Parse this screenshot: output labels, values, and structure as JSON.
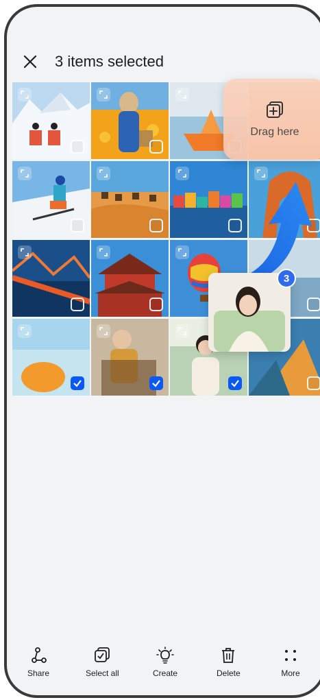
{
  "header": {
    "title": "3 items selected"
  },
  "drag_target": {
    "label": "Drag here"
  },
  "drag_preview": {
    "count": "3"
  },
  "toolbar": {
    "share": "Share",
    "select_all": "Select all",
    "create": "Create",
    "delete": "Delete",
    "more": "More"
  },
  "colors": {
    "accent": "#0a59f7",
    "badge": "#2f6bf0",
    "background": "#f1f3f5"
  },
  "photos": [
    {
      "subject": "snow-skiers",
      "checked": false
    },
    {
      "subject": "girl-flower-field",
      "checked": false
    },
    {
      "subject": "paper-boat",
      "checked": false
    },
    {
      "subject": "cloud",
      "checked": false
    },
    {
      "subject": "skier",
      "checked": false
    },
    {
      "subject": "desert-camels",
      "checked": false
    },
    {
      "subject": "colorful-houses",
      "checked": false
    },
    {
      "subject": "rock-arch",
      "checked": false
    },
    {
      "subject": "bridge",
      "checked": false
    },
    {
      "subject": "temple",
      "checked": false
    },
    {
      "subject": "hot-air-balloon",
      "checked": false
    },
    {
      "subject": "lake",
      "checked": false
    },
    {
      "subject": "beach-umbrella",
      "checked": true
    },
    {
      "subject": "woman-chair",
      "checked": true
    },
    {
      "subject": "woman-smiling",
      "checked": true
    },
    {
      "subject": "tent",
      "checked": false
    }
  ]
}
